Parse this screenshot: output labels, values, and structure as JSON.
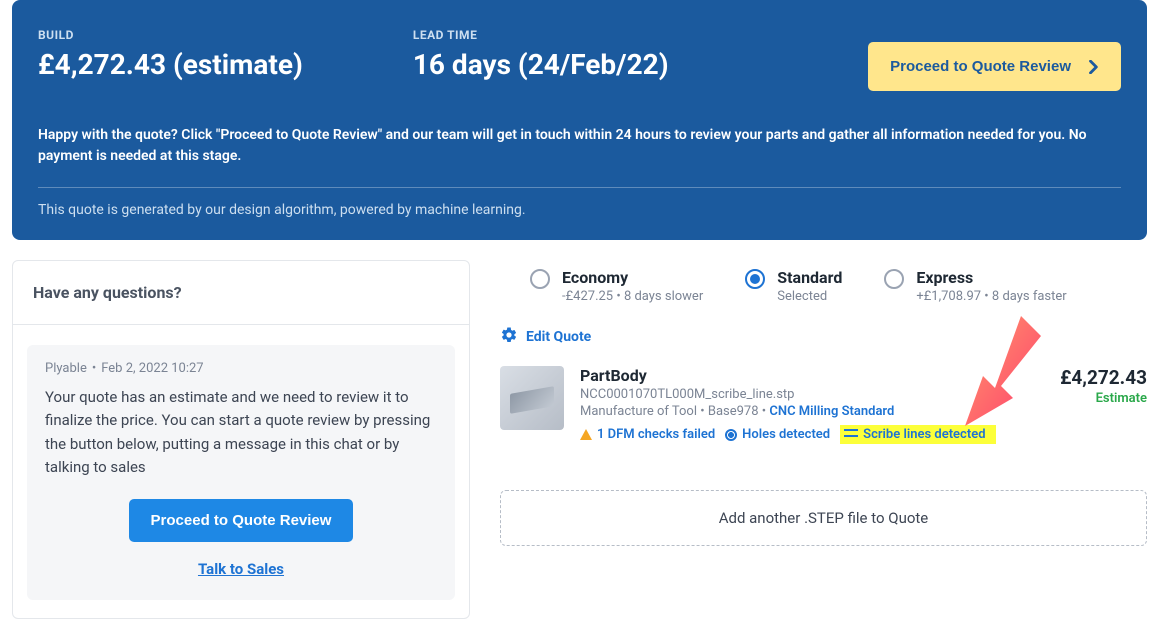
{
  "header": {
    "build_label": "BUILD",
    "build_value": "£4,272.43 (estimate)",
    "leadtime_label": "LEAD TIME",
    "leadtime_value": "16 days (24/Feb/22)",
    "proceed_button": "Proceed to Quote Review",
    "description": "Happy with the quote? Click \"Proceed to Quote Review\" and our team will get in touch within 24 hours to review your parts and gather all information needed for you. No payment is needed at this stage.",
    "footer_note": "This quote is generated by our design algorithm, powered by machine learning."
  },
  "questions": {
    "title": "Have any questions?",
    "author": "Plyable",
    "timestamp": "Feb 2, 2022 10:27",
    "body": "Your quote has an estimate and we need to review it to finalize the price. You can start a quote review by pressing the button below, putting a message in this chat or by talking to sales",
    "proceed_button": "Proceed to Quote Review",
    "talk_link": "Talk to Sales"
  },
  "delivery_options": [
    {
      "label": "Economy",
      "sub": "-£427.25 • 8 days slower",
      "selected": false
    },
    {
      "label": "Standard",
      "sub": "Selected",
      "selected": true
    },
    {
      "label": "Express",
      "sub": "+£1,708.97 • 8 days faster",
      "selected": false
    }
  ],
  "edit_quote_label": "Edit Quote",
  "part": {
    "name": "PartBody",
    "file": "NCC0001070TL000M_scribe_line.stp",
    "meta_prefix": "Manufacture of Tool • Base978 • ",
    "meta_link": "CNC Milling Standard",
    "dfm_text": "1 DFM checks failed",
    "holes_text": "Holes detected",
    "scribe_text": "Scribe lines detected",
    "price": "£4,272.43",
    "price_sub": "Estimate"
  },
  "add_step_label": "Add another .STEP file to Quote"
}
